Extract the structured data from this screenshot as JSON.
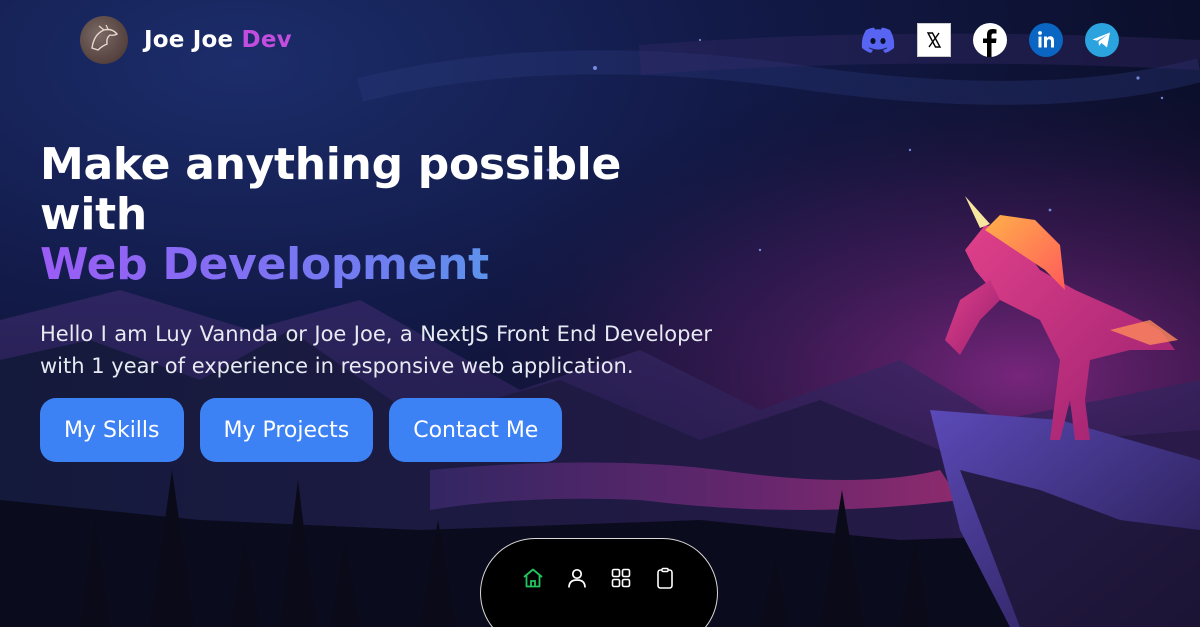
{
  "brand": {
    "name_part1": "Joe Joe",
    "name_part2": "Dev"
  },
  "socials": [
    {
      "icon": "discord-icon",
      "color": "#5865f2"
    },
    {
      "icon": "x-icon",
      "color": "#000000"
    },
    {
      "icon": "facebook-icon",
      "color": "#ffffff"
    },
    {
      "icon": "linkedin-icon",
      "color": "#0a66c2"
    },
    {
      "icon": "telegram-icon",
      "color": "#2aa3df"
    }
  ],
  "hero": {
    "headline_line1": "Make anything possible with",
    "headline_line2": "Web Development",
    "intro": "Hello I am Luy Vannda or Joe Joe, a NextJS Front End Developer with 1 year of experience in responsive web application."
  },
  "cta": {
    "skills_label": "My Skills",
    "projects_label": "My Projects",
    "contact_label": "Contact Me"
  },
  "bottom_nav": {
    "items": [
      {
        "icon": "home-icon",
        "active": true
      },
      {
        "icon": "user-icon",
        "active": false
      },
      {
        "icon": "grid-icon",
        "active": false
      },
      {
        "icon": "clipboard-icon",
        "active": false
      }
    ]
  },
  "colors": {
    "accent_purple": "#c24dde",
    "button_blue": "#3d82f5",
    "active_green": "#22c55e",
    "background": "#0b0f2a"
  }
}
